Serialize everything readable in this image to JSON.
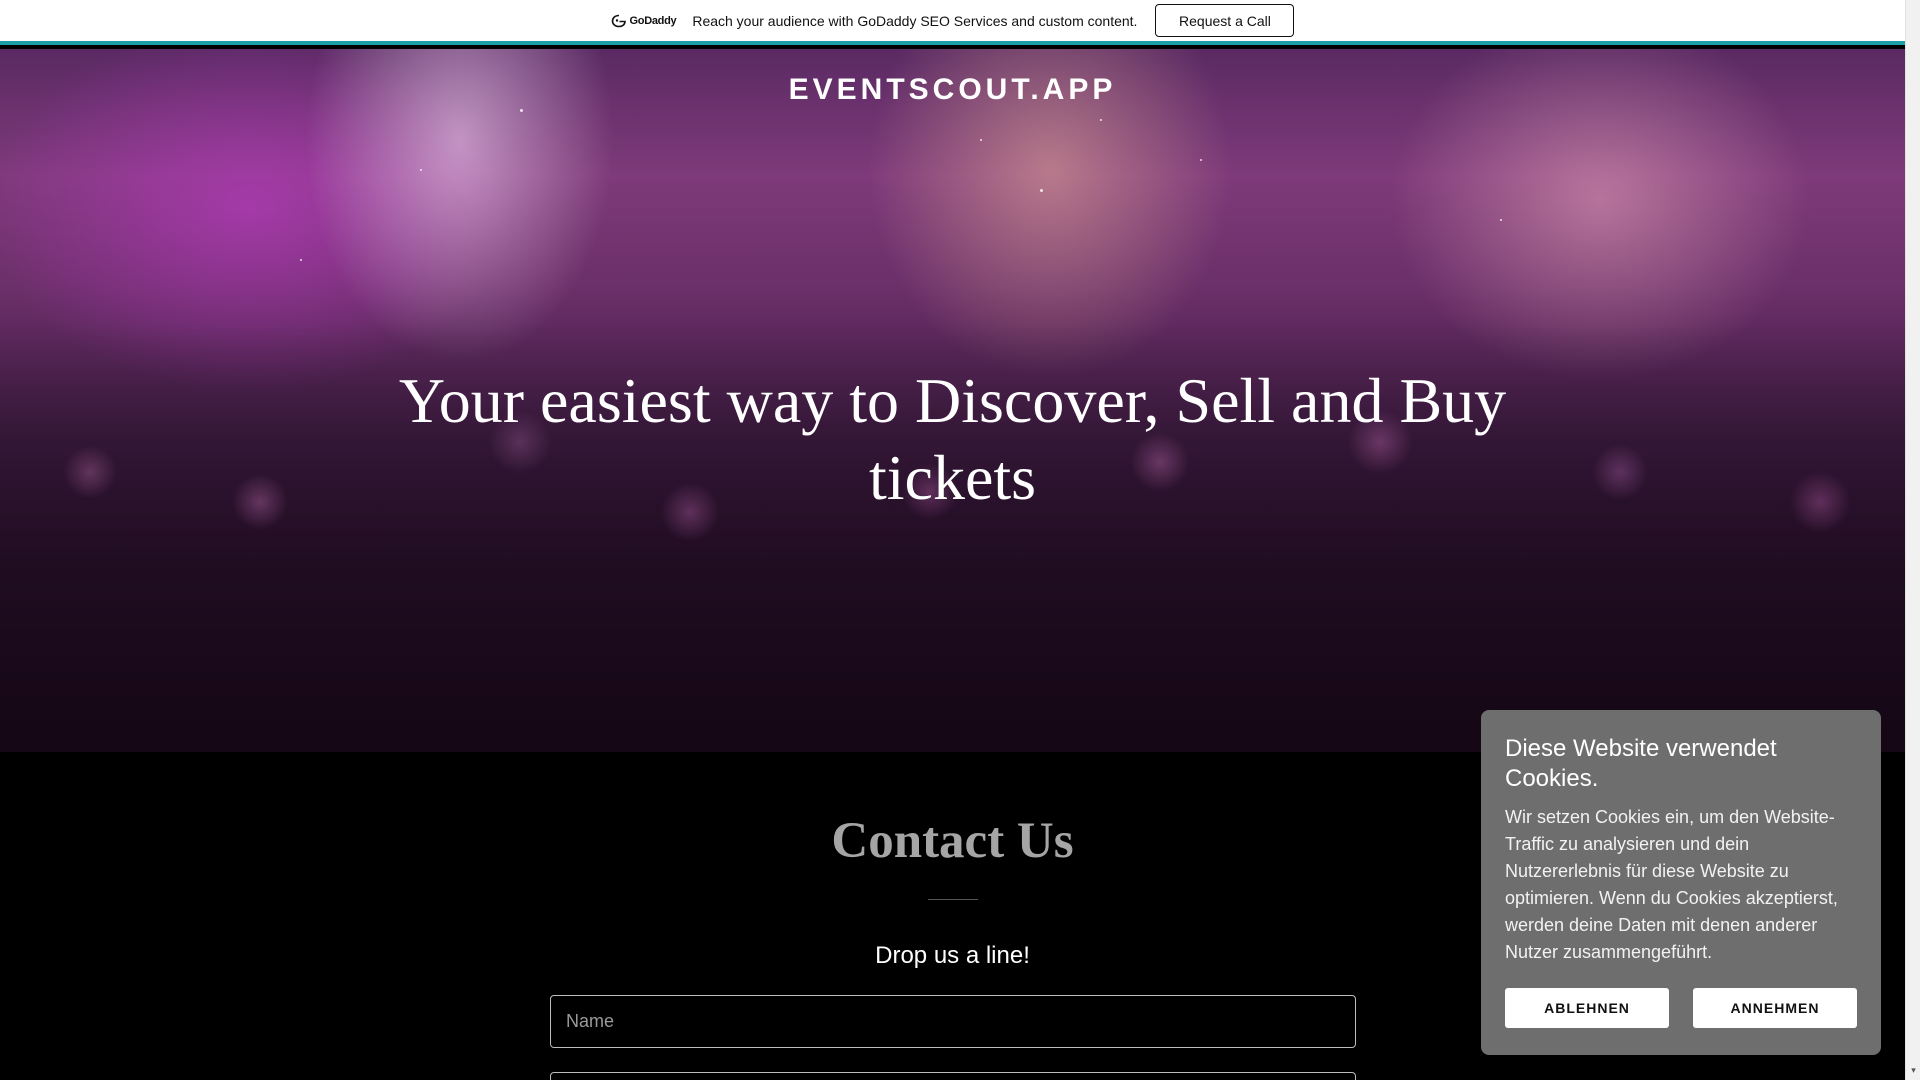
{
  "topbar": {
    "logo_text": "GoDaddy",
    "logo_icon": "godaddy-logo-icon",
    "message": "Reach your audience with GoDaddy SEO Services and custom content.",
    "cta_label": "Request a Call",
    "accent_color": "#1aa0a6"
  },
  "hero": {
    "site_title": "EVENTSCOUT.APP",
    "heading": "Your easiest way to Discover, Sell and Buy tickets"
  },
  "contact": {
    "title": "Contact Us",
    "subtitle": "Drop us a line!",
    "name_placeholder": "Name"
  },
  "cookie_banner": {
    "title": "Diese Website verwendet Cookies.",
    "body": "Wir setzen Cookies ein, um den Website-Traffic zu analysieren und dein Nutzererlebnis für diese Website zu optimieren. Wenn du Cookies akzeptierst, werden deine Daten mit denen anderer Nutzer zusammengeführt.",
    "decline_label": "ABLEHNEN",
    "accept_label": "ANNEHMEN"
  }
}
